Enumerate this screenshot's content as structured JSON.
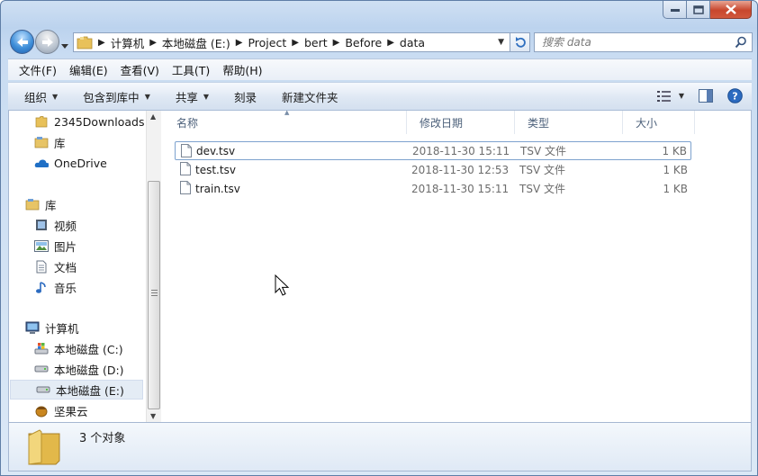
{
  "window": {
    "caption_buttons": [
      "minimize",
      "maximize",
      "close"
    ]
  },
  "address_bar": {
    "crumbs": [
      "计算机",
      "本地磁盘 (E:)",
      "Project",
      "bert",
      "Before",
      "data"
    ]
  },
  "search": {
    "placeholder": "搜索 data"
  },
  "menu": {
    "items": [
      "文件(F)",
      "编辑(E)",
      "查看(V)",
      "工具(T)",
      "帮助(H)"
    ]
  },
  "command_bar": {
    "organize": "组织",
    "include_in_library": "包含到库中",
    "share": "共享",
    "burn": "刻录",
    "new_folder": "新建文件夹"
  },
  "nav_pane": {
    "items": [
      {
        "label": "2345Downloads",
        "icon": "folder-icon"
      },
      {
        "label": "库",
        "icon": "library-icon"
      },
      {
        "label": "OneDrive",
        "icon": "onedrive-icon"
      },
      {
        "label": "库",
        "icon": "library-icon"
      },
      {
        "label": "视频",
        "icon": "video-icon"
      },
      {
        "label": "图片",
        "icon": "pictures-icon"
      },
      {
        "label": "文档",
        "icon": "documents-icon"
      },
      {
        "label": "音乐",
        "icon": "music-icon"
      },
      {
        "label": "计算机",
        "icon": "computer-icon"
      },
      {
        "label": "本地磁盘 (C:)",
        "icon": "system-drive-icon"
      },
      {
        "label": "本地磁盘 (D:)",
        "icon": "drive-icon"
      },
      {
        "label": "本地磁盘 (E:)",
        "icon": "drive-icon",
        "selected": true
      },
      {
        "label": "坚果云",
        "icon": "nutstore-icon"
      }
    ]
  },
  "file_list": {
    "columns": [
      "名称",
      "修改日期",
      "类型",
      "大小"
    ],
    "rows": [
      {
        "name": "dev.tsv",
        "modified": "2018-11-30 15:11",
        "type": "TSV 文件",
        "size": "1 KB"
      },
      {
        "name": "test.tsv",
        "modified": "2018-11-30 12:53",
        "type": "TSV 文件",
        "size": "1 KB"
      },
      {
        "name": "train.tsv",
        "modified": "2018-11-30 15:11",
        "type": "TSV 文件",
        "size": "1 KB"
      }
    ]
  },
  "details_pane": {
    "count_text": "3 个对象"
  },
  "colors": {
    "accent": "#3f8fd9",
    "close_button": "#c8472d",
    "selection": "#e4ecf5"
  }
}
